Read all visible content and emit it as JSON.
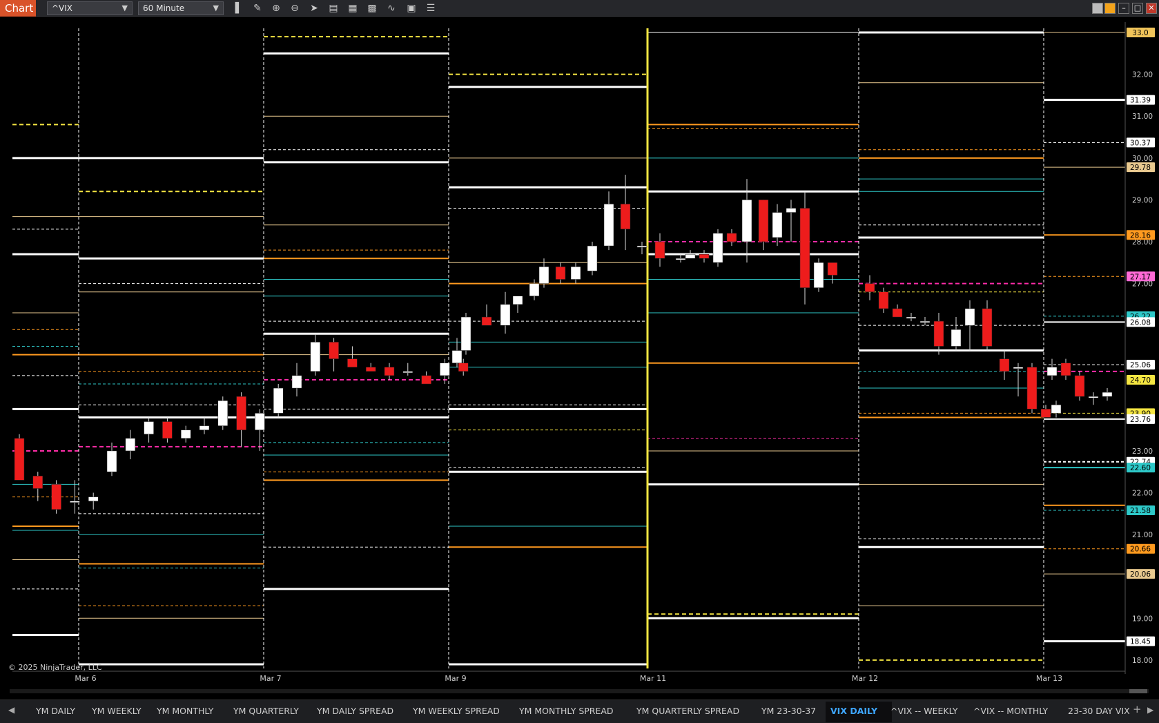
{
  "toolbar": {
    "chart_label": "Chart",
    "instrument": "^VIX",
    "interval": "60 Minute",
    "tools": [
      "bar-type-icon",
      "draw-pencil-icon",
      "zoom-in-icon",
      "zoom-out-icon",
      "pointer-icon",
      "data-box-icon",
      "properties-icon",
      "templates-icon",
      "strategy-icon",
      "indicator-icon",
      "list-icon"
    ]
  },
  "copyright": "© 2025 NinjaTrader, LLC",
  "colors": {
    "background": "#000000",
    "up_candle": "#ffffff",
    "down_candle": "#ee1c1c",
    "yellow": "#f5e642",
    "orange": "#ff9a1f",
    "cyan": "#2ec8c8",
    "magenta": "#ff2ca8",
    "tan": "#e9c98f",
    "white": "#ffffff"
  },
  "chart_data": {
    "type": "candlestick",
    "instrument": "^VIX",
    "interval": "60 Minute",
    "ylim": [
      17.8,
      33.1
    ],
    "x_labels": [
      {
        "bar": 4,
        "label": "Mar 6"
      },
      {
        "bar": 14,
        "label": "Mar 7"
      },
      {
        "bar": 24,
        "label": "Mar 9"
      },
      {
        "bar": 35,
        "label": "Mar 11"
      },
      {
        "bar": 46,
        "label": "Mar 12"
      },
      {
        "bar": 56,
        "label": "Mar 13"
      }
    ],
    "y_ticks": [
      "18.00",
      "19.00",
      "21.00",
      "22.00",
      "23.00",
      "28.00",
      "29.00",
      "30.00",
      "31.00",
      "32.00",
      "27.00",
      "25.06",
      "24.70"
    ],
    "price_markers": [
      {
        "label": "33.0",
        "price": 33.0,
        "color": "#f0c45a"
      },
      {
        "label": "31.39",
        "price": 31.39,
        "color": "#ffffff"
      },
      {
        "label": "30.37",
        "price": 30.37,
        "color": "#ffffff"
      },
      {
        "label": "29.78",
        "price": 29.78,
        "color": "#e9c98f"
      },
      {
        "label": "28.16",
        "price": 28.16,
        "color": "#ff9a1f"
      },
      {
        "label": "27.17",
        "price": 27.17,
        "color": "#ff6ad5"
      },
      {
        "label": "26.22",
        "price": 26.22,
        "color": "#2ec8c8"
      },
      {
        "label": "26.08",
        "price": 26.08,
        "color": "#ffffff"
      },
      {
        "label": "25.06",
        "price": 25.06,
        "color": "#ffffff"
      },
      {
        "label": "24.70",
        "price": 24.7,
        "color": "#f5e642"
      },
      {
        "label": "23.90",
        "price": 23.9,
        "color": "#f5e642"
      },
      {
        "label": "23.76",
        "price": 23.76,
        "color": "#ffffff"
      },
      {
        "label": "22.74",
        "price": 22.74,
        "color": "#ffffff"
      },
      {
        "label": "22.60",
        "price": 22.6,
        "color": "#2ec8c8"
      },
      {
        "label": "21.58",
        "price": 21.58,
        "color": "#2ec8c8"
      },
      {
        "label": "20.66",
        "price": 20.66,
        "color": "#ff9a1f"
      },
      {
        "label": "20.06",
        "price": 20.06,
        "color": "#e9c98f"
      },
      {
        "label": "18.45",
        "price": 18.45,
        "color": "#ffffff"
      }
    ],
    "candles": [
      {
        "o": 23.3,
        "h": 23.4,
        "l": 22.4,
        "c": 22.3
      },
      {
        "o": 22.4,
        "h": 22.5,
        "l": 21.8,
        "c": 22.1
      },
      {
        "o": 22.2,
        "h": 22.3,
        "l": 21.5,
        "c": 21.6
      },
      {
        "o": 21.8,
        "h": 22.3,
        "l": 21.5,
        "c": 21.8
      },
      {
        "o": 21.8,
        "h": 22.0,
        "l": 21.6,
        "c": 21.9
      },
      {
        "o": 22.5,
        "h": 23.2,
        "l": 22.4,
        "c": 23.0
      },
      {
        "o": 23.0,
        "h": 23.5,
        "l": 22.8,
        "c": 23.3
      },
      {
        "o": 23.4,
        "h": 23.8,
        "l": 23.2,
        "c": 23.7
      },
      {
        "o": 23.7,
        "h": 23.8,
        "l": 23.2,
        "c": 23.3
      },
      {
        "o": 23.3,
        "h": 23.6,
        "l": 23.2,
        "c": 23.5
      },
      {
        "o": 23.5,
        "h": 23.8,
        "l": 23.4,
        "c": 23.6
      },
      {
        "o": 23.6,
        "h": 24.3,
        "l": 23.5,
        "c": 24.2
      },
      {
        "o": 24.3,
        "h": 24.4,
        "l": 23.1,
        "c": 23.5
      },
      {
        "o": 23.5,
        "h": 24.0,
        "l": 23.0,
        "c": 23.9
      },
      {
        "o": 23.9,
        "h": 24.6,
        "l": 23.8,
        "c": 24.5
      },
      {
        "o": 24.5,
        "h": 25.1,
        "l": 24.3,
        "c": 24.8
      },
      {
        "o": 24.9,
        "h": 25.8,
        "l": 24.8,
        "c": 25.6
      },
      {
        "o": 25.6,
        "h": 25.7,
        "l": 24.9,
        "c": 25.2
      },
      {
        "o": 25.2,
        "h": 25.5,
        "l": 25.0,
        "c": 25.0
      },
      {
        "o": 25.0,
        "h": 25.1,
        "l": 24.9,
        "c": 24.9
      },
      {
        "o": 25.0,
        "h": 25.1,
        "l": 24.7,
        "c": 24.8
      },
      {
        "o": 24.9,
        "h": 25.1,
        "l": 24.8,
        "c": 24.9
      },
      {
        "o": 24.8,
        "h": 24.9,
        "l": 24.6,
        "c": 24.6
      },
      {
        "o": 24.8,
        "h": 25.2,
        "l": 24.6,
        "c": 25.1
      },
      {
        "o": 25.1,
        "h": 25.2,
        "l": 24.8,
        "c": 24.9
      }
    ],
    "levels": []
  },
  "tabs": [
    {
      "label": "YM DAILY"
    },
    {
      "label": "YM WEEKLY"
    },
    {
      "label": "YM MONTHLY"
    },
    {
      "label": "YM QUARTERLY"
    },
    {
      "label": "YM DAILY SPREAD"
    },
    {
      "label": "YM WEEKLY SPREAD"
    },
    {
      "label": "YM MONTHLY SPREAD"
    },
    {
      "label": "YM QUARTERLY SPREAD"
    },
    {
      "label": "YM 23-30-37"
    },
    {
      "label": "VIX DAILY"
    },
    {
      "label": "^VIX -- WEEKLY"
    },
    {
      "label": "^VIX -- MONTHLY"
    },
    {
      "label": "23-30 DAY VIX"
    }
  ],
  "active_tab": "VIX DAILY"
}
